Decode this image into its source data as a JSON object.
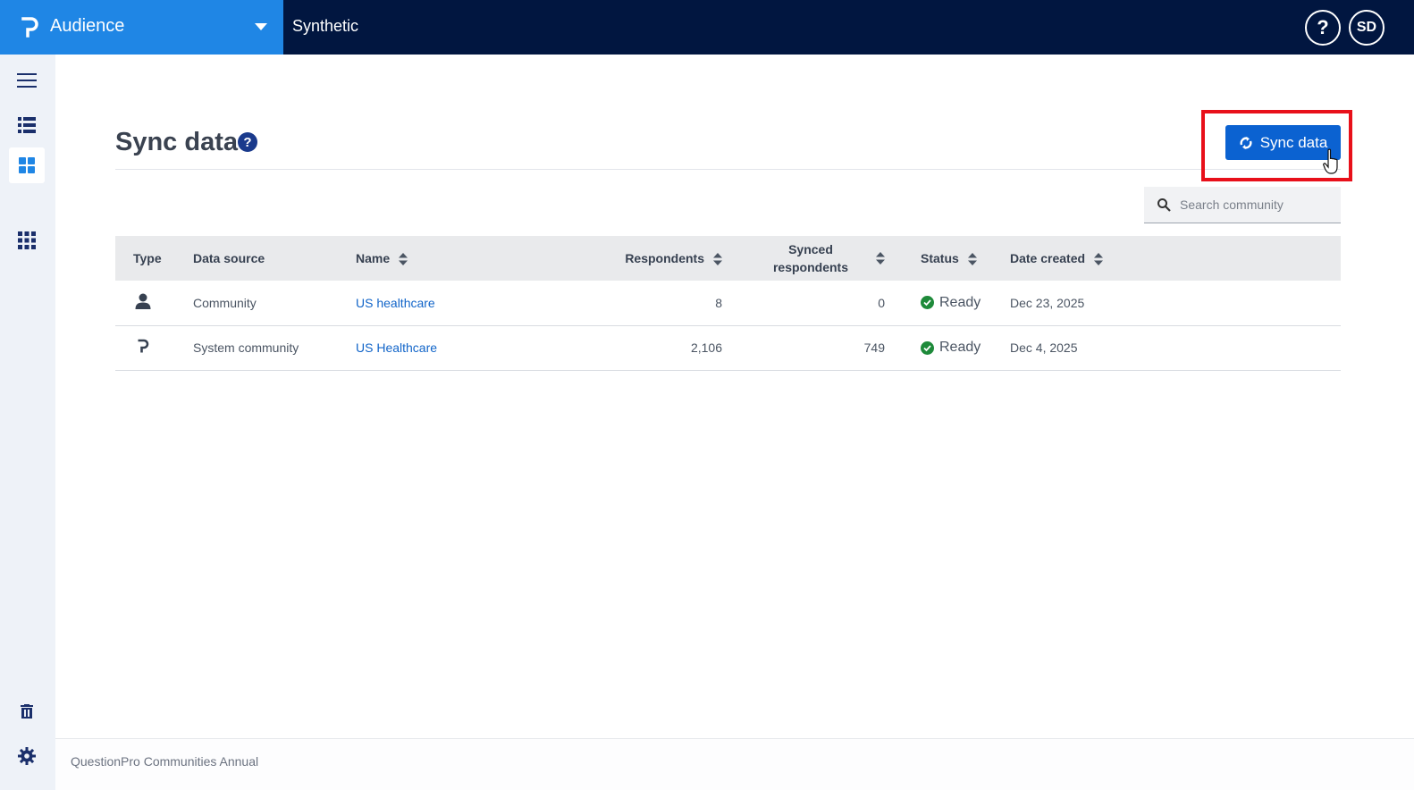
{
  "topbar": {
    "app_name": "Audience",
    "project_title": "Synthetic",
    "help_label": "?",
    "avatar_initials": "SD"
  },
  "sidebar": {
    "items": [
      {
        "icon": "menu-icon"
      },
      {
        "icon": "list-icon"
      },
      {
        "icon": "dashboard-icon",
        "active": true
      },
      {
        "icon": "apps-grid-icon"
      },
      {
        "icon": "trash-icon"
      },
      {
        "icon": "gear-icon"
      }
    ]
  },
  "page": {
    "title": "Sync data",
    "help_label": "?",
    "sync_button_label": "Sync data",
    "search_placeholder": "Search community"
  },
  "table": {
    "headers": {
      "type": "Type",
      "data_source": "Data source",
      "name": "Name",
      "respondents": "Respondents",
      "synced_respondents": "Synced respondents",
      "status": "Status",
      "date_created": "Date created"
    },
    "rows": [
      {
        "type_icon": "person-icon",
        "data_source": "Community",
        "name": "US healthcare",
        "respondents": "8",
        "synced": "0",
        "status": "Ready",
        "date_created": "Dec 23, 2025"
      },
      {
        "type_icon": "questionpro-logo-icon",
        "data_source": "System community",
        "name": "US Healthcare",
        "respondents": "2,106",
        "synced": "749",
        "status": "Ready",
        "date_created": "Dec 4, 2025"
      }
    ]
  },
  "footer": {
    "text": "QuestionPro Communities Annual"
  },
  "colors": {
    "topbar": "#011640",
    "app_switch": "#1f86e5",
    "primary_button": "#0b62d1",
    "link": "#1265c9",
    "status_ok": "#1e8a3a",
    "highlight": "#e8101a"
  }
}
